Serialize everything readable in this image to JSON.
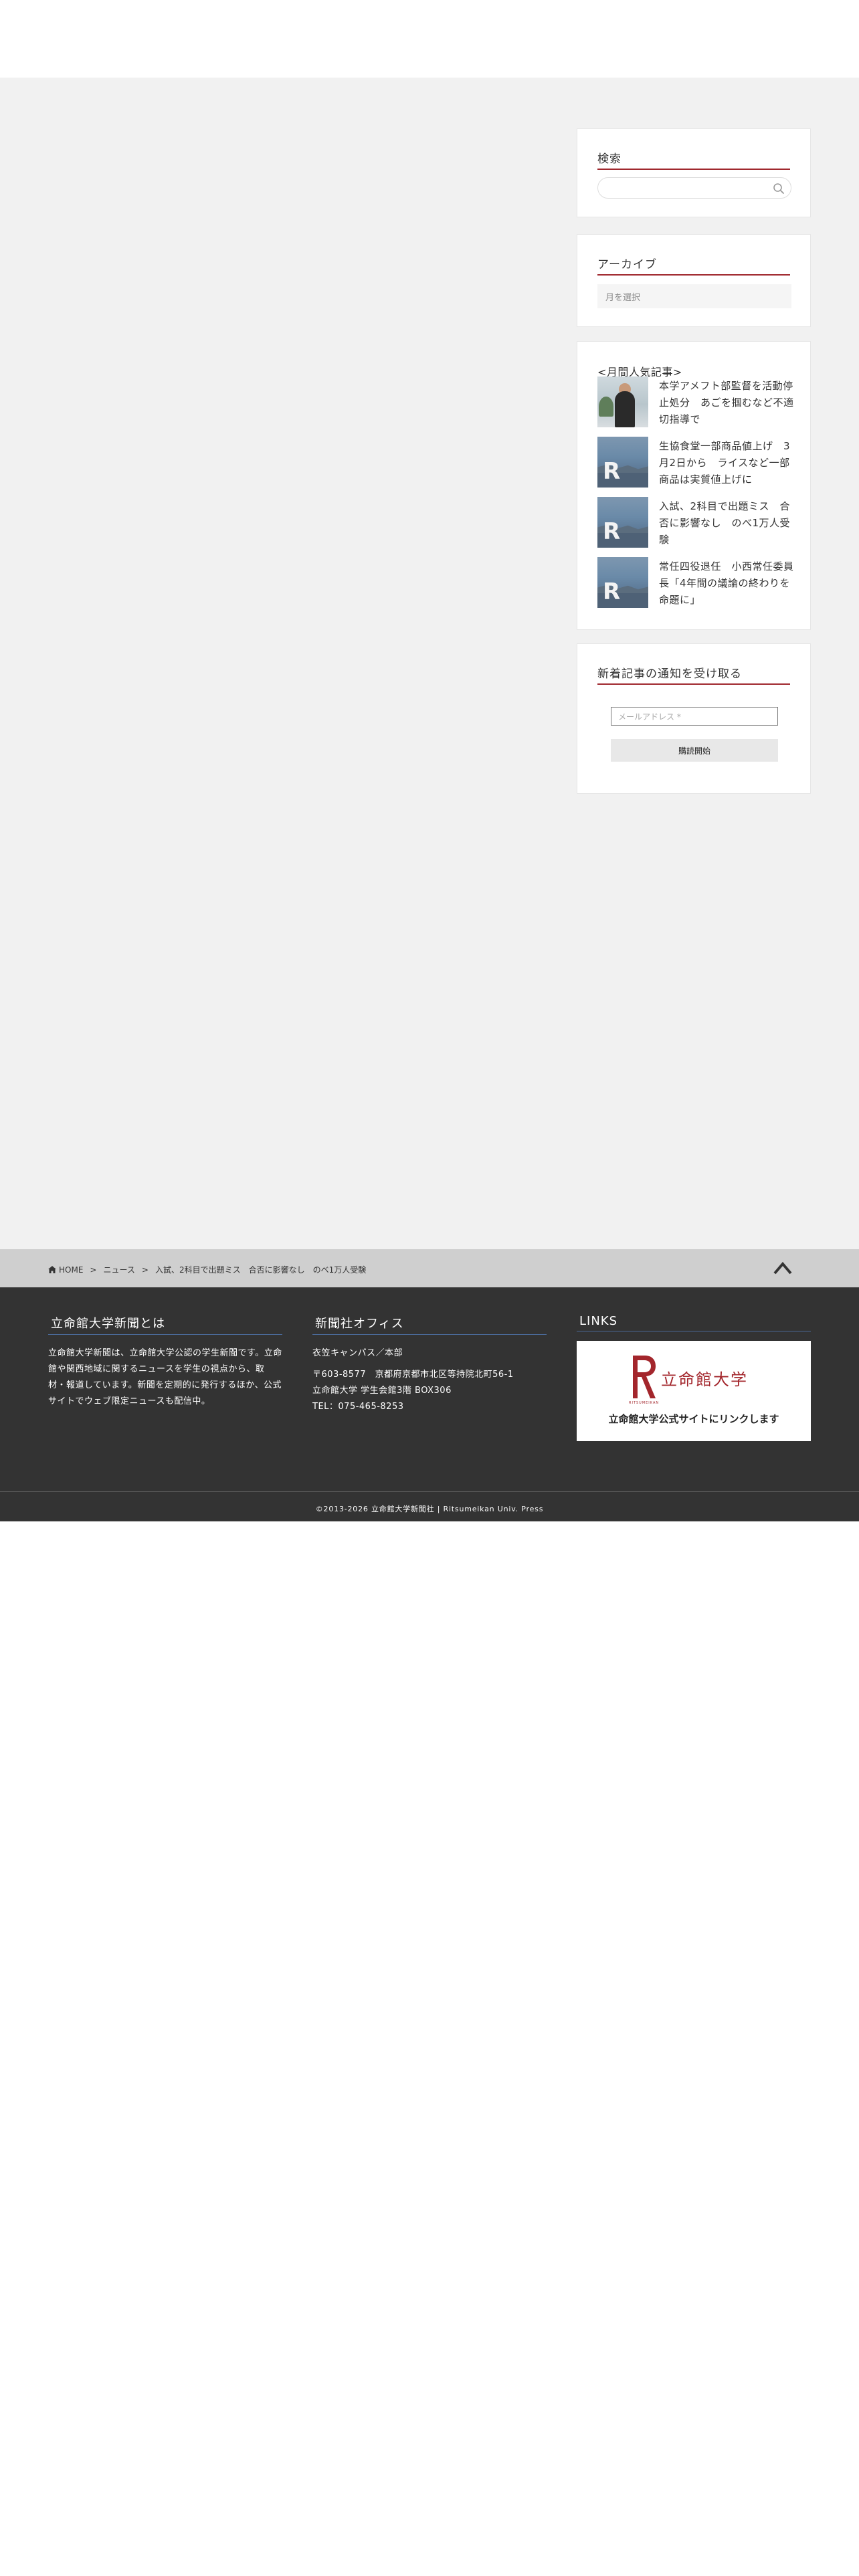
{
  "sidebar": {
    "search": {
      "title": "検索",
      "placeholder": "",
      "icon": "search-icon"
    },
    "archive": {
      "title": "アーカイブ",
      "select_value": "月を選択"
    },
    "popular": {
      "title": "<月間人気記事>",
      "items": [
        {
          "text": "本学アメフト部監督を活動停止処分　あごを掴むなど不適切指導で"
        },
        {
          "text": "生協食堂一部商品値上げ　3月2日から　ライスなど一部商品は実質値上げに"
        },
        {
          "text": "入試、2科目で出題ミス　合否に影響なし　のべ1万人受験"
        },
        {
          "text": "常任四役退任　小西常任委員長「4年間の議論の終わりを命題に」"
        }
      ]
    },
    "notify": {
      "title": "新着記事の通知を受け取る",
      "email_placeholder": "メールアドレス *",
      "button_label": "購読開始"
    }
  },
  "breadcrumb": {
    "home": "HOME",
    "sep": ">",
    "items": [
      "ニュース",
      "入試、2科目で出題ミス　合否に影響なし　のべ1万人受験"
    ]
  },
  "footer": {
    "about": {
      "title": "立命館大学新聞とは",
      "text": "立命館大学新聞は、立命館大学公認の学生新聞です。立命館や関西地域に関するニュースを学生の視点から、取材・報道しています。新聞を定期的に発行するほか、公式サイトでウェブ限定ニュースも配信中。"
    },
    "office": {
      "title": "新聞社オフィス",
      "campus": "衣笠キャンパス／本部",
      "address": "〒603-8577　京都府京都市北区等持院北町56-1",
      "building": "立命館大学 学生会館3階 BOX306",
      "tel": "TEL：075-465-8253"
    },
    "links": {
      "title": "LINKS",
      "banner_name": "立命館大学",
      "banner_sub": "RITSUMEIKAN",
      "banner_tagline": "立命館大学公式サイトにリンクします"
    },
    "copyright": "©2013-2026  立命館大学新聞社 | Ritsumeikan Univ. Press"
  },
  "colors": {
    "accent": "#a0282e",
    "footer_bg": "#333333",
    "link_underline": "#4b6b9a"
  }
}
